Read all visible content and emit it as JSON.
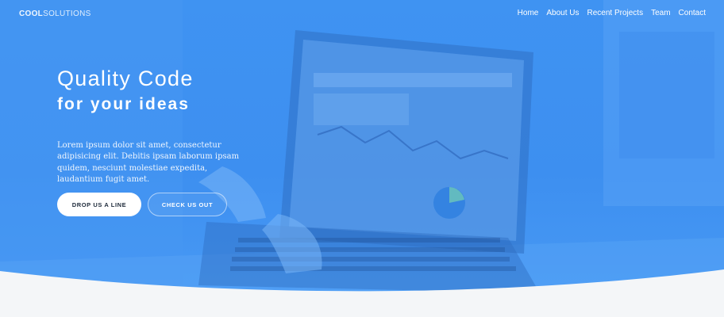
{
  "brand": {
    "bold": "COOL",
    "light": "SOLUTIONS"
  },
  "nav": {
    "items": [
      {
        "label": "Home"
      },
      {
        "label": "About Us"
      },
      {
        "label": "Recent Projects"
      },
      {
        "label": "Team"
      },
      {
        "label": "Contact"
      }
    ]
  },
  "hero": {
    "title": "Quality Code",
    "subtitle": "for your ideas",
    "body": "Lorem ipsum dolor sit amet, consectetur adipisicing elit. Debitis ipsam laborum ipsam quidem, nesciunt molestiae expedita, laudantium fugit amet.",
    "primary_cta": "DROP US A LINE",
    "secondary_cta": "CHECK US OUT"
  },
  "colors": {
    "accent": "#3d8ff0",
    "footer_bg": "#f4f6f8"
  },
  "background_image": "laptop-with-analytics-dashboard"
}
